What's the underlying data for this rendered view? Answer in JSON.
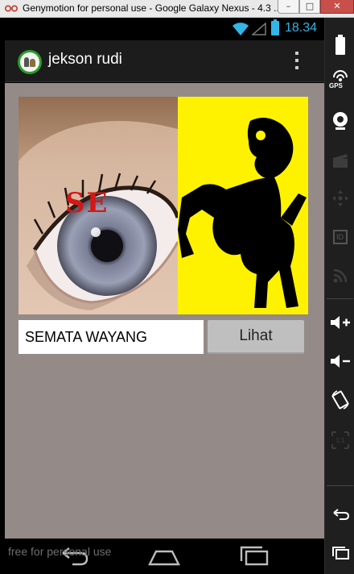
{
  "window": {
    "title": "Genymotion for personal use - Google Galaxy Nexus - 4.3 ...",
    "minimize_label": "–",
    "maximize_label": "□",
    "close_label": "✕"
  },
  "statusbar": {
    "time": "18.34",
    "accent_color": "#33b5e5"
  },
  "actionbar": {
    "title": "jekson rudi",
    "overflow_icon": "overflow-menu-icon"
  },
  "banner": {
    "overlay_text": "SE",
    "left_image": "eye-closeup",
    "right_image": "wayang-puppet-silhouette",
    "right_background": "#fff200"
  },
  "form": {
    "input_value": "SEMATA WAYANG",
    "button_label": "Lihat"
  },
  "navbar": {
    "back_icon": "back-icon",
    "home_icon": "home-icon",
    "recents_icon": "recents-icon"
  },
  "watermark": "free for personal use",
  "sidepanel": {
    "tools": [
      "battery-icon",
      "gps-icon",
      "webcam-icon",
      "capture-icon",
      "dpad-icon",
      "id-icon",
      "rss-icon",
      "volume-up-icon",
      "volume-down-icon",
      "rotate-icon",
      "scale-icon",
      "back-icon",
      "recents-icon"
    ],
    "gps_label": "GPS",
    "id_label": "ID",
    "scale_label": "1:1"
  }
}
